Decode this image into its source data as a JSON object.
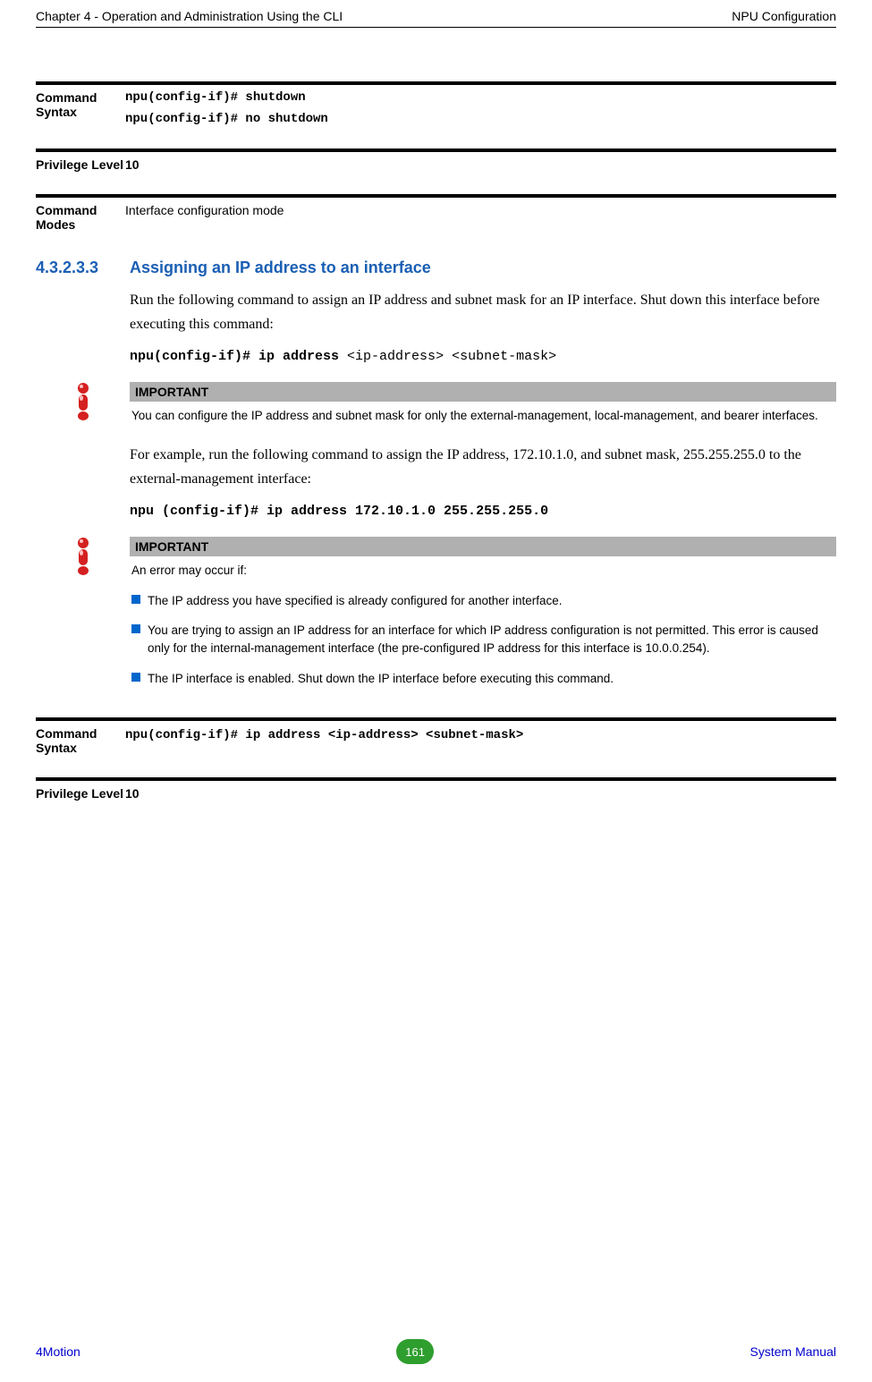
{
  "header": {
    "left": "Chapter 4 - Operation and Administration Using the CLI",
    "right": "NPU Configuration"
  },
  "blocks": {
    "cmd_syntax1_label": "Command Syntax",
    "cmd_syntax1_line1": "npu(config-if)# shutdown",
    "cmd_syntax1_line2": "npu(config-if)# no shutdown",
    "priv1_label": "Privilege Level",
    "priv1_value": "10",
    "modes_label": "Command Modes",
    "modes_value": "Interface configuration mode"
  },
  "section": {
    "num": "4.3.2.3.3",
    "title": "Assigning an IP address to an interface",
    "p1": "Run the following command to assign an IP address and subnet mask for an IP interface. Shut down this interface before executing this command:",
    "code1_prefix": "npu(config-if)# ip address ",
    "code1_args": "<ip-address> <subnet-mask>",
    "p2": "For example, run the following command to assign the IP address, 172.10.1.0, and subnet mask, 255.255.255.0 to the external-management interface:",
    "code2": "npu (config-if)# ip address 172.10.1.0 255.255.255.0"
  },
  "callout1": {
    "title": "IMPORTANT",
    "body": "You can configure the IP address and subnet mask for only the external-management, local-management, and bearer interfaces."
  },
  "callout2": {
    "title": "IMPORTANT",
    "intro": "An error may occur if:",
    "bullets": [
      "The IP address you have specified is already configured for another interface.",
      "You are trying to assign an IP address for an interface for which IP address configuration is not permitted. This error is caused only for the internal-management interface (the pre-configured IP address for this interface is 10.0.0.254).",
      "The IP interface is enabled. Shut down the IP interface before executing this command."
    ]
  },
  "blocks2": {
    "cmd_syntax2_label": "Command Syntax",
    "cmd_syntax2_prefix": "npu(config-if)# ip address ",
    "cmd_syntax2_args": "<ip-address> <subnet-mask>",
    "priv2_label": "Privilege Level",
    "priv2_value": "10"
  },
  "footer": {
    "left": "4Motion",
    "page": "161",
    "right": "System Manual"
  }
}
